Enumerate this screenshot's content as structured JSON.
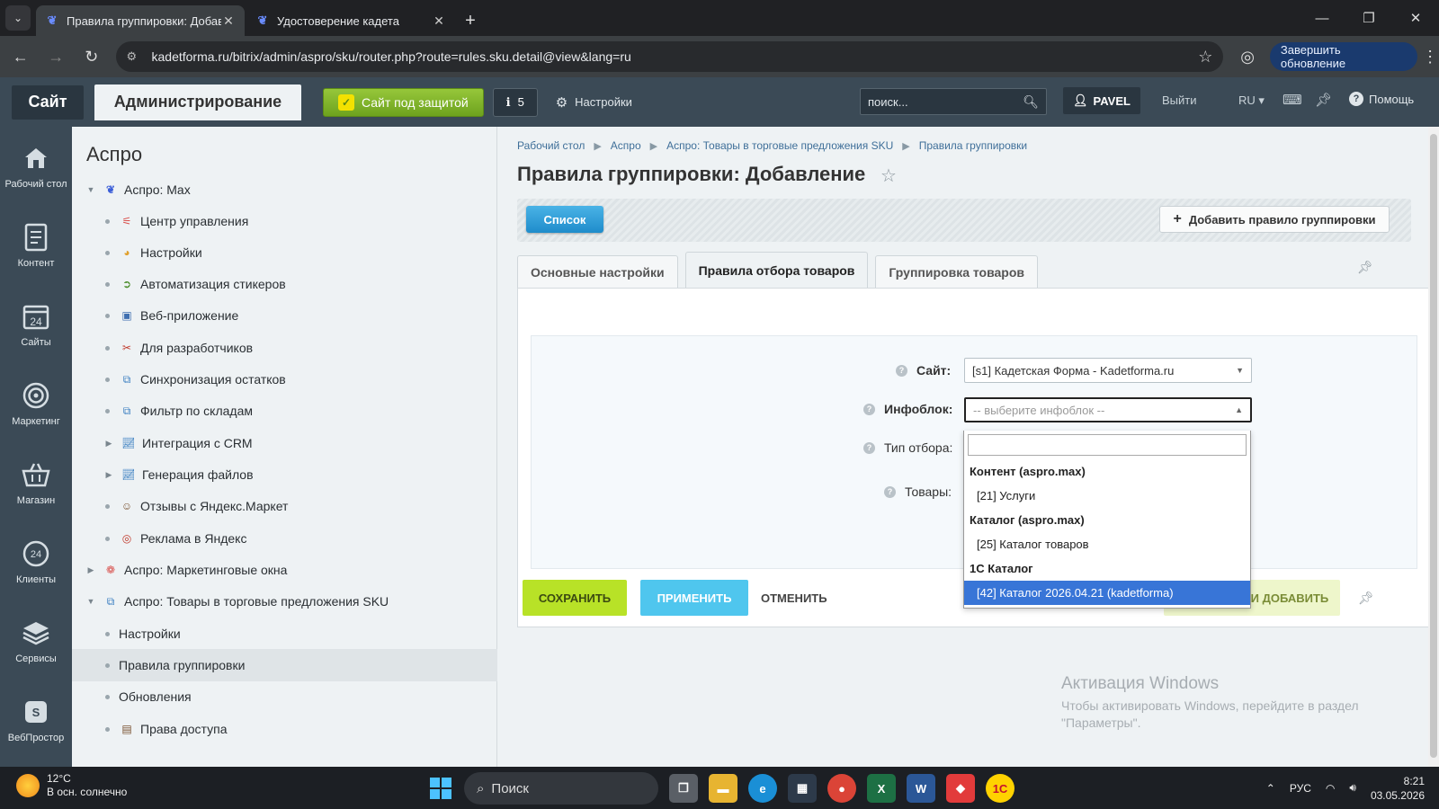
{
  "browser": {
    "tabs": [
      {
        "title": "Правила группировки: Добав",
        "active": true
      },
      {
        "title": "Удостоверение кадета",
        "active": false
      }
    ],
    "url": "kadetforma.ru/bitrix/admin/aspro/sku/router.php?route=rules.sku.detail@view&lang=ru",
    "update_button": "Завершить обновление"
  },
  "adminbar": {
    "site": "Сайт",
    "admin": "Администрирование",
    "secure": "Сайт под защитой",
    "notifications_count": "5",
    "settings": "Настройки",
    "search_placeholder": "поиск...",
    "user": "PAVEL",
    "logout": "Выйти",
    "lang": "RU",
    "help": "Помощь"
  },
  "rail": [
    {
      "label": "Рабочий стол",
      "icon": "home-icon"
    },
    {
      "label": "Контент",
      "icon": "document-icon"
    },
    {
      "label": "Сайты",
      "icon": "calendar-24-icon"
    },
    {
      "label": "Маркетинг",
      "icon": "target-icon"
    },
    {
      "label": "Магазин",
      "icon": "basket-icon"
    },
    {
      "label": "Клиенты",
      "icon": "clients-24-icon"
    },
    {
      "label": "Сервисы",
      "icon": "layers-icon"
    },
    {
      "label": "ВебПростор",
      "icon": "webprostor-icon"
    }
  ],
  "sidebar": {
    "title": "Аспро",
    "items": [
      {
        "label": "Аспро: Max",
        "level": 0,
        "arrow": "▼"
      },
      {
        "label": "Центр управления",
        "level": 1
      },
      {
        "label": "Настройки",
        "level": 1
      },
      {
        "label": "Автоматизация стикеров",
        "level": 1
      },
      {
        "label": "Веб-приложение",
        "level": 1
      },
      {
        "label": "Для разработчиков",
        "level": 1
      },
      {
        "label": "Синхронизация остатков",
        "level": 1
      },
      {
        "label": "Фильтр по складам",
        "level": 1
      },
      {
        "label": "Интеграция с CRM",
        "level": 1,
        "arrow": "▶"
      },
      {
        "label": "Генерация файлов",
        "level": 1,
        "arrow": "▶"
      },
      {
        "label": "Отзывы с Яндекс.Маркет",
        "level": 1
      },
      {
        "label": "Реклама в Яндекс",
        "level": 1
      },
      {
        "label": "Аспро: Маркетинговые окна",
        "level": 0,
        "arrow": "▶"
      },
      {
        "label": "Аспро: Товары в торговые предложения SKU",
        "level": 0,
        "arrow": "▼"
      },
      {
        "label": "Настройки",
        "level": 2
      },
      {
        "label": "Правила группировки",
        "level": 2,
        "selected": true
      },
      {
        "label": "Обновления",
        "level": 2
      },
      {
        "label": "Права доступа",
        "level": 2
      }
    ]
  },
  "breadcrumb": [
    "Рабочий стол",
    "Аспро",
    "Аспро: Товары в торговые предложения SKU",
    "Правила группировки"
  ],
  "page": {
    "title": "Правила группировки: Добавление",
    "list_button": "Список",
    "add_rule_button": "Добавить правило группировки",
    "tabs": [
      {
        "label": "Основные настройки",
        "active": false
      },
      {
        "label": "Правила отбора товаров",
        "active": true
      },
      {
        "label": "Группировка товаров",
        "active": false
      }
    ]
  },
  "form": {
    "site_label": "Сайт:",
    "site_value": "[s1] Кадетская Форма - Kadetforma.ru",
    "iblock_label": "Инфоблок:",
    "iblock_placeholder": "-- выберите инфоблок --",
    "filter_type_label": "Тип отбора:",
    "products_label": "Товары:"
  },
  "dropdown": {
    "options": [
      {
        "label": "Контент (aspro.max)",
        "group": true
      },
      {
        "label": "[21] Услуги",
        "group": false
      },
      {
        "label": "Каталог (aspro.max)",
        "group": true
      },
      {
        "label": "[25] Каталог товаров",
        "group": false
      },
      {
        "label": "1С Каталог",
        "group": true
      },
      {
        "label": "[42] Каталог 2026.04.21 (kadetforma)",
        "group": false,
        "highlighted": true
      }
    ]
  },
  "buttons": {
    "save": "СОХРАНИТЬ",
    "apply": "ПРИМЕНИТЬ",
    "cancel": "ОТМЕНИТЬ",
    "save_add": "СОХРАНИТЬ И ДОБАВИТЬ"
  },
  "watermark": {
    "title": "Активация Windows",
    "text": "Чтобы активировать Windows, перейдите в раздел \"Параметры\"."
  },
  "taskbar": {
    "temp": "12°C",
    "weather": "В осн. солнечно",
    "search": "Поиск",
    "lang": "РУС",
    "time": "8:21",
    "date": "03.05.2026"
  },
  "colors": {
    "admin_bar": "#3b4a56",
    "save_green": "#b8e227",
    "apply_blue": "#4fc6ee",
    "list_blue": "#1e8ccb",
    "highlight": "#3875d7"
  }
}
